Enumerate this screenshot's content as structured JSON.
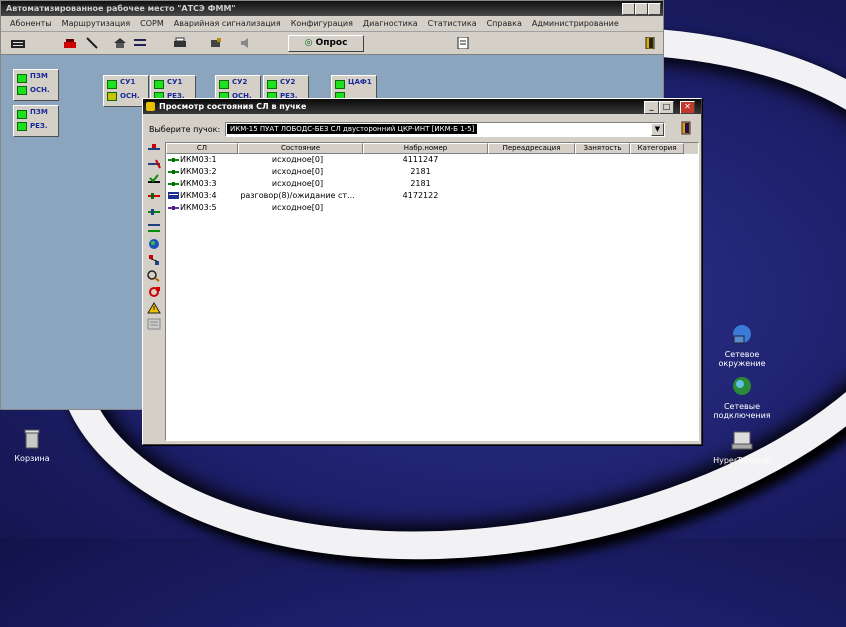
{
  "main_window": {
    "title": "Автоматизированное рабочее место \"АТСЭ ФММ\"",
    "menu": [
      "Абоненты",
      "Маршрутизация",
      "СОРМ",
      "Аварийная сигнализация",
      "Конфигурация",
      "Диагностика",
      "Статистика",
      "Справка",
      "Администрирование"
    ],
    "opros_label": "Опрос",
    "nodes": [
      {
        "top": "ПЗМ",
        "bottom": "ОСН."
      },
      {
        "top": "ПЗМ",
        "bottom": "РЕЗ."
      },
      {
        "top": "СУ1",
        "bottom": "ОСН."
      },
      {
        "top": "СУ1",
        "bottom": "РЕЗ."
      },
      {
        "top": "СУ2",
        "bottom": "ОСН."
      },
      {
        "top": "СУ2",
        "bottom": "РЕЗ."
      },
      {
        "top": "ЦАФ1",
        "bottom": ""
      }
    ]
  },
  "dialog": {
    "title": "Просмотр состояния СЛ в пучке",
    "select_label": "Выберите пучок:",
    "select_value": "ИКМ-15 ПУАТ ЛОБОДС-БЕЗ СЛ двусторонний ЦКР-ИНТ [ИКМ-Б 1-5]",
    "columns": [
      "СЛ",
      "Состояние",
      "Набр.номер",
      "Переадресация",
      "Занятость",
      "Категория"
    ],
    "rows": [
      {
        "sl": "ИКМ03:1",
        "state": "исходное[0]",
        "num": "4111247",
        "fwd": "",
        "busy": "",
        "cat": "",
        "icon": "line-green"
      },
      {
        "sl": "ИКМ03:2",
        "state": "исходное[0]",
        "num": "2181",
        "fwd": "",
        "busy": "",
        "cat": "",
        "icon": "line-green"
      },
      {
        "sl": "ИКМ03:3",
        "state": "исходное[0]",
        "num": "2181",
        "fwd": "",
        "busy": "",
        "cat": "",
        "icon": "line-green"
      },
      {
        "sl": "ИКМ03:4",
        "state": "разговор(8)/ожидание ст...",
        "num": "4172122",
        "fwd": "",
        "busy": "",
        "cat": "",
        "icon": "line-blue"
      },
      {
        "sl": "ИКМ03:5",
        "state": "исходное[0]",
        "num": "",
        "fwd": "",
        "busy": "",
        "cat": "",
        "icon": "line-purple"
      }
    ]
  },
  "desktop": {
    "icons": [
      {
        "label": "Корзина",
        "icon": "recycle-bin-icon"
      },
      {
        "label": "Сетевое окружение",
        "icon": "network-places-icon"
      },
      {
        "label": "Сетевые подключения",
        "icon": "network-connections-icon"
      },
      {
        "label": "HyperTerminal",
        "icon": "hyperterminal-icon"
      }
    ]
  },
  "colors": {
    "desktop_bg": "#1d1f6a",
    "workspace_bg": "#8ba5bf",
    "node_green": "#1ee01e",
    "titlebar": "#0a0a0a"
  }
}
